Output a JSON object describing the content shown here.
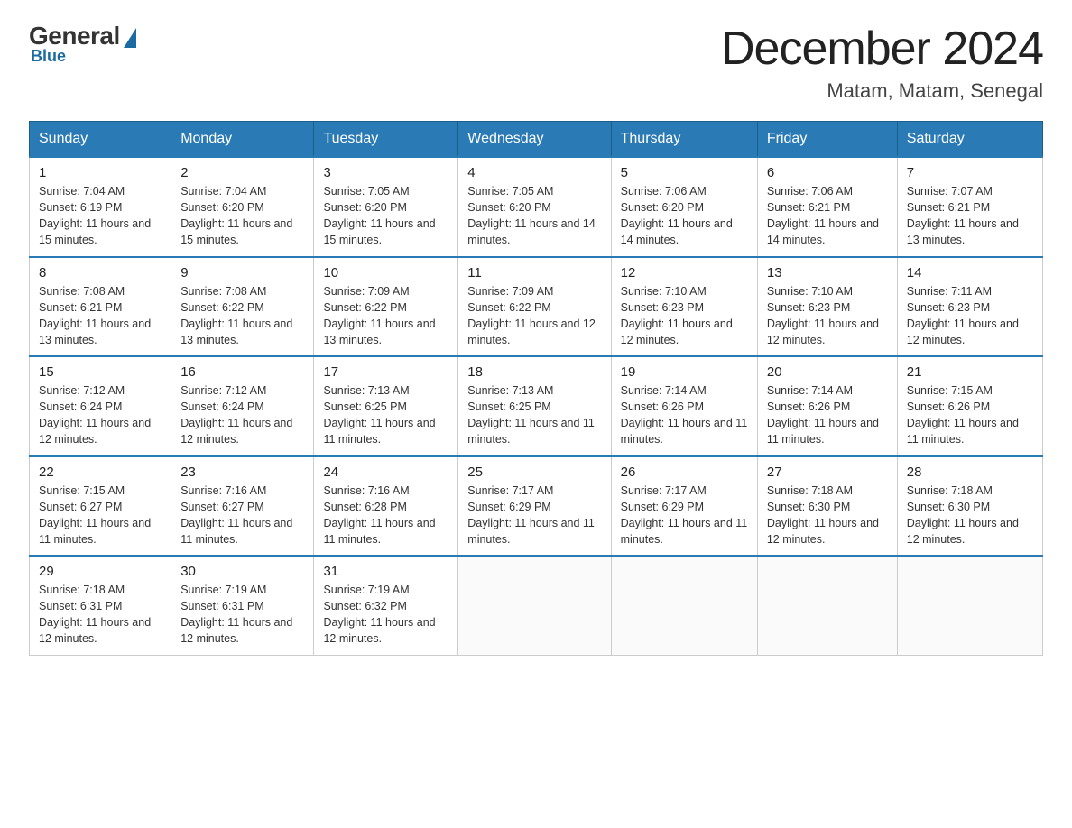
{
  "header": {
    "logo": {
      "general": "General",
      "blue": "Blue"
    },
    "title": "December 2024",
    "location": "Matam, Matam, Senegal"
  },
  "days_of_week": [
    "Sunday",
    "Monday",
    "Tuesday",
    "Wednesday",
    "Thursday",
    "Friday",
    "Saturday"
  ],
  "weeks": [
    [
      {
        "day": "1",
        "sunrise": "7:04 AM",
        "sunset": "6:19 PM",
        "daylight": "11 hours and 15 minutes."
      },
      {
        "day": "2",
        "sunrise": "7:04 AM",
        "sunset": "6:20 PM",
        "daylight": "11 hours and 15 minutes."
      },
      {
        "day": "3",
        "sunrise": "7:05 AM",
        "sunset": "6:20 PM",
        "daylight": "11 hours and 15 minutes."
      },
      {
        "day": "4",
        "sunrise": "7:05 AM",
        "sunset": "6:20 PM",
        "daylight": "11 hours and 14 minutes."
      },
      {
        "day": "5",
        "sunrise": "7:06 AM",
        "sunset": "6:20 PM",
        "daylight": "11 hours and 14 minutes."
      },
      {
        "day": "6",
        "sunrise": "7:06 AM",
        "sunset": "6:21 PM",
        "daylight": "11 hours and 14 minutes."
      },
      {
        "day": "7",
        "sunrise": "7:07 AM",
        "sunset": "6:21 PM",
        "daylight": "11 hours and 13 minutes."
      }
    ],
    [
      {
        "day": "8",
        "sunrise": "7:08 AM",
        "sunset": "6:21 PM",
        "daylight": "11 hours and 13 minutes."
      },
      {
        "day": "9",
        "sunrise": "7:08 AM",
        "sunset": "6:22 PM",
        "daylight": "11 hours and 13 minutes."
      },
      {
        "day": "10",
        "sunrise": "7:09 AM",
        "sunset": "6:22 PM",
        "daylight": "11 hours and 13 minutes."
      },
      {
        "day": "11",
        "sunrise": "7:09 AM",
        "sunset": "6:22 PM",
        "daylight": "11 hours and 12 minutes."
      },
      {
        "day": "12",
        "sunrise": "7:10 AM",
        "sunset": "6:23 PM",
        "daylight": "11 hours and 12 minutes."
      },
      {
        "day": "13",
        "sunrise": "7:10 AM",
        "sunset": "6:23 PM",
        "daylight": "11 hours and 12 minutes."
      },
      {
        "day": "14",
        "sunrise": "7:11 AM",
        "sunset": "6:23 PM",
        "daylight": "11 hours and 12 minutes."
      }
    ],
    [
      {
        "day": "15",
        "sunrise": "7:12 AM",
        "sunset": "6:24 PM",
        "daylight": "11 hours and 12 minutes."
      },
      {
        "day": "16",
        "sunrise": "7:12 AM",
        "sunset": "6:24 PM",
        "daylight": "11 hours and 12 minutes."
      },
      {
        "day": "17",
        "sunrise": "7:13 AM",
        "sunset": "6:25 PM",
        "daylight": "11 hours and 11 minutes."
      },
      {
        "day": "18",
        "sunrise": "7:13 AM",
        "sunset": "6:25 PM",
        "daylight": "11 hours and 11 minutes."
      },
      {
        "day": "19",
        "sunrise": "7:14 AM",
        "sunset": "6:26 PM",
        "daylight": "11 hours and 11 minutes."
      },
      {
        "day": "20",
        "sunrise": "7:14 AM",
        "sunset": "6:26 PM",
        "daylight": "11 hours and 11 minutes."
      },
      {
        "day": "21",
        "sunrise": "7:15 AM",
        "sunset": "6:26 PM",
        "daylight": "11 hours and 11 minutes."
      }
    ],
    [
      {
        "day": "22",
        "sunrise": "7:15 AM",
        "sunset": "6:27 PM",
        "daylight": "11 hours and 11 minutes."
      },
      {
        "day": "23",
        "sunrise": "7:16 AM",
        "sunset": "6:27 PM",
        "daylight": "11 hours and 11 minutes."
      },
      {
        "day": "24",
        "sunrise": "7:16 AM",
        "sunset": "6:28 PM",
        "daylight": "11 hours and 11 minutes."
      },
      {
        "day": "25",
        "sunrise": "7:17 AM",
        "sunset": "6:29 PM",
        "daylight": "11 hours and 11 minutes."
      },
      {
        "day": "26",
        "sunrise": "7:17 AM",
        "sunset": "6:29 PM",
        "daylight": "11 hours and 11 minutes."
      },
      {
        "day": "27",
        "sunrise": "7:18 AM",
        "sunset": "6:30 PM",
        "daylight": "11 hours and 12 minutes."
      },
      {
        "day": "28",
        "sunrise": "7:18 AM",
        "sunset": "6:30 PM",
        "daylight": "11 hours and 12 minutes."
      }
    ],
    [
      {
        "day": "29",
        "sunrise": "7:18 AM",
        "sunset": "6:31 PM",
        "daylight": "11 hours and 12 minutes."
      },
      {
        "day": "30",
        "sunrise": "7:19 AM",
        "sunset": "6:31 PM",
        "daylight": "11 hours and 12 minutes."
      },
      {
        "day": "31",
        "sunrise": "7:19 AM",
        "sunset": "6:32 PM",
        "daylight": "11 hours and 12 minutes."
      },
      null,
      null,
      null,
      null
    ]
  ]
}
